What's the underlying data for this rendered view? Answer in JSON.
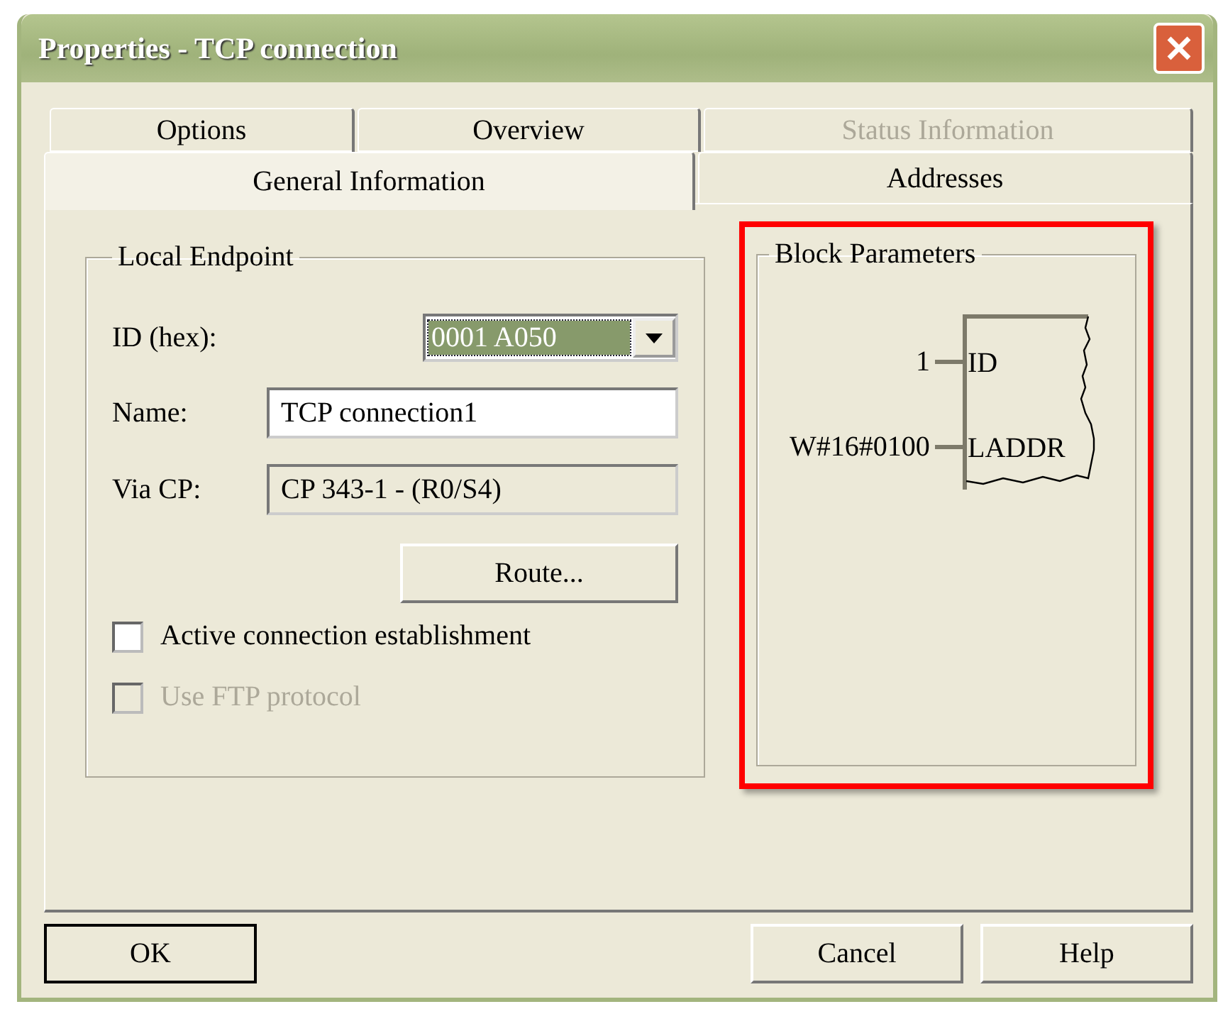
{
  "window": {
    "title": "Properties - TCP connection"
  },
  "tab_rows": [
    [
      {
        "label": "Options",
        "selected": false,
        "disabled": false
      },
      {
        "label": "Overview",
        "selected": false,
        "disabled": false
      },
      {
        "label": "Status Information",
        "selected": false,
        "disabled": true
      }
    ],
    [
      {
        "label": "General Information",
        "selected": true,
        "disabled": false
      },
      {
        "label": "Addresses",
        "selected": false,
        "disabled": false
      }
    ]
  ],
  "local_endpoint": {
    "title": "Local Endpoint",
    "id_field": {
      "label": "ID (hex):",
      "value": "0001 A050"
    },
    "name_field": {
      "label": "Name:",
      "value": "TCP connection1"
    },
    "via_cp_field": {
      "label": "Via CP:",
      "value": "CP 343-1 - (R0/S4)"
    },
    "route_button": "Route...",
    "checkboxes": [
      {
        "label": "Active connection establishment",
        "checked": false,
        "disabled": false
      },
      {
        "label": "Use FTP protocol",
        "checked": false,
        "disabled": true
      }
    ]
  },
  "block_parameters": {
    "title": "Block Parameters",
    "highlighted": true,
    "pins": [
      {
        "value": "1",
        "name": "ID"
      },
      {
        "value": "W#16#0100",
        "name": "LADDR"
      }
    ]
  },
  "buttons": [
    {
      "label": "OK",
      "default": true
    },
    {
      "label": "Cancel",
      "default": false
    },
    {
      "label": "Help",
      "default": false
    }
  ]
}
